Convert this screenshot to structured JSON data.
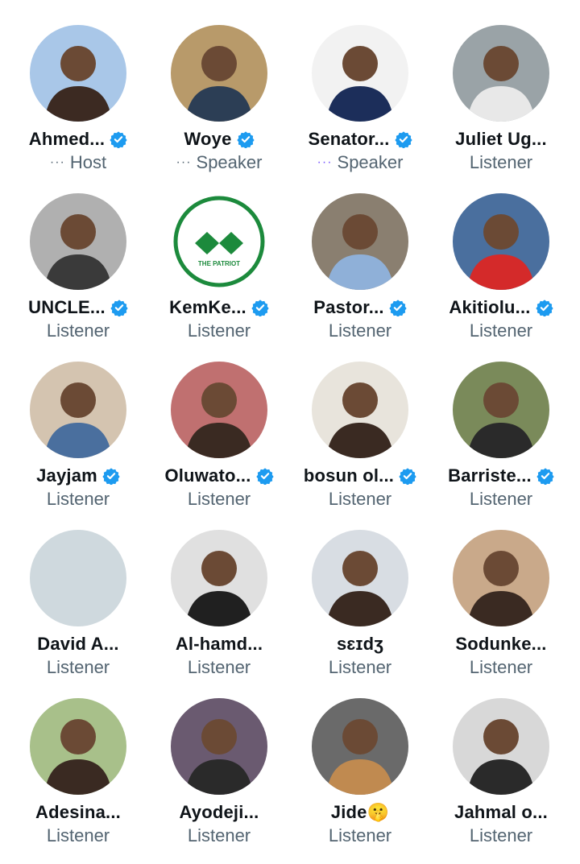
{
  "people": [
    {
      "name": "Ahmed...",
      "role": "Host",
      "verified": true,
      "indicator": "···",
      "avatar_bg": "#a9c7e8",
      "avatar_fg": "#3c2a22"
    },
    {
      "name": "Woye",
      "role": "Speaker",
      "verified": true,
      "indicator": "···",
      "avatar_bg": "#b89a6a",
      "avatar_fg": "#2c3e55"
    },
    {
      "name": "Senator...",
      "role": "Speaker",
      "verified": true,
      "indicator": "···",
      "avatar_bg": "#f2f2f2",
      "avatar_fg": "#1c2e5a"
    },
    {
      "name": "Juliet Ug...",
      "role": "Listener",
      "verified": false,
      "indicator": "",
      "avatar_bg": "#9aa3a7",
      "avatar_fg": "#e8e8e8"
    },
    {
      "name": "UNCLE...",
      "role": "Listener",
      "verified": true,
      "indicator": "",
      "avatar_bg": "#b0b0b0",
      "avatar_fg": "#3a3a3a"
    },
    {
      "name": "KemKe...",
      "role": "Listener",
      "verified": true,
      "indicator": "",
      "avatar_bg": "#ffffff",
      "avatar_fg": "#1c8a3c",
      "logo_text": "THE PATRIOT"
    },
    {
      "name": "Pastor...",
      "role": "Listener",
      "verified": true,
      "indicator": "",
      "avatar_bg": "#8a7f70",
      "avatar_fg": "#8fb0d8"
    },
    {
      "name": "Akitiolu...",
      "role": "Listener",
      "verified": true,
      "indicator": "",
      "avatar_bg": "#4a6f9e",
      "avatar_fg": "#d42a2a"
    },
    {
      "name": "Jayjam",
      "role": "Listener",
      "verified": true,
      "indicator": "",
      "avatar_bg": "#d4c4b0",
      "avatar_fg": "#4a6f9e"
    },
    {
      "name": "Oluwato...",
      "role": "Listener",
      "verified": true,
      "indicator": "",
      "avatar_bg": "#c07070",
      "avatar_fg": "#3a2a22"
    },
    {
      "name": "bosun ol...",
      "role": "Listener",
      "verified": true,
      "indicator": "",
      "avatar_bg": "#e8e4dc",
      "avatar_fg": "#3a2a22"
    },
    {
      "name": "Barriste...",
      "role": "Listener",
      "verified": true,
      "indicator": "",
      "avatar_bg": "#7a8a5a",
      "avatar_fg": "#2a2a2a"
    },
    {
      "name": "David A...",
      "role": "Listener",
      "verified": false,
      "indicator": "",
      "avatar_bg": "#cfd9de",
      "avatar_fg": "",
      "placeholder": true
    },
    {
      "name": "Al-hamd...",
      "role": "Listener",
      "verified": false,
      "indicator": "",
      "avatar_bg": "#e0e0e0",
      "avatar_fg": "#202020"
    },
    {
      "name": "sɛɪdʒ",
      "role": "Listener",
      "verified": false,
      "indicator": "",
      "avatar_bg": "#d8dde3",
      "avatar_fg": "#3a2a22"
    },
    {
      "name": "Sodunke...",
      "role": "Listener",
      "verified": false,
      "indicator": "",
      "avatar_bg": "#c9a98a",
      "avatar_fg": "#3a2a22"
    },
    {
      "name": "Adesina...",
      "role": "Listener",
      "verified": false,
      "indicator": "",
      "avatar_bg": "#a8c08a",
      "avatar_fg": "#3a2a22"
    },
    {
      "name": "Ayodeji...",
      "role": "Listener",
      "verified": false,
      "indicator": "",
      "avatar_bg": "#6a5a70",
      "avatar_fg": "#2a2a2a"
    },
    {
      "name": "Jide🤫",
      "role": "Listener",
      "verified": false,
      "indicator": "",
      "avatar_bg": "#6a6a6a",
      "avatar_fg": "#c08a50"
    },
    {
      "name": "Jahmal o...",
      "role": "Listener",
      "verified": false,
      "indicator": "",
      "avatar_bg": "#d8d8d8",
      "avatar_fg": "#2a2a2a"
    }
  ],
  "colors": {
    "verified": "#1d9bf0",
    "name_text": "#0f1419",
    "role_text": "#536471",
    "speaking_dots": "#7856ff"
  }
}
